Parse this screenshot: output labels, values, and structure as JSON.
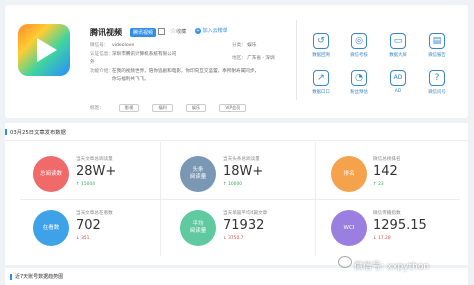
{
  "profile": {
    "name": "腾讯视频",
    "badge": "腾讯视频",
    "fav_label": "收藏",
    "cloud_add_label": "加入云榜单",
    "wechat_label": "微信号：",
    "wechat_value": "videolove",
    "auth_label": "认证信息：",
    "auth_value": "深圳市腾讯计算机系统有限公司",
    "auth_suffix": "外",
    "func_label": "功能介绍：",
    "func_value": "在我的视频世界，陪你追剧和电影，你印向互交蓝蕾，奉所耐寿属同步，",
    "func_value2": "你与福利共飞飞。",
    "category_label": "分类：",
    "category_value": "娱乐",
    "region_label": "地区：",
    "region_value": "广东省 · 深圳",
    "tags_label": "标签：",
    "tags": [
      "影视",
      "福利",
      "娱乐",
      "VIP会员"
    ]
  },
  "tools": [
    {
      "label": "数据回溯",
      "icon": "history-icon"
    },
    {
      "label": "微信考核",
      "icon": "wechat-icon"
    },
    {
      "label": "数据大屏",
      "icon": "screen-icon"
    },
    {
      "label": "微信报告",
      "icon": "report-icon"
    },
    {
      "label": "数据口口",
      "icon": "data-icon"
    },
    {
      "label": "粉丝预估",
      "icon": "fans-icon"
    },
    {
      "label": "AD",
      "icon": "ad-icon"
    },
    {
      "label": "微信问号",
      "icon": "question-icon"
    }
  ],
  "section_title": "03月25日文章发布数据",
  "metrics": [
    {
      "circle": "总阅读数",
      "color": "#f06a6a",
      "label": "当天文章总阅读量",
      "value": "28W+",
      "delta": "↑ 15004",
      "delta_color": "#3aa65a"
    },
    {
      "circle": "头条\n阅读量",
      "color": "#7a97b3",
      "label": "当天头条总阅读量",
      "value": "18W+",
      "delta": "↑ 10000",
      "delta_color": "#3aa65a"
    },
    {
      "circle": "排名",
      "color": "#f4a34c",
      "label": "微信总榜排名",
      "value": "142",
      "delta": "↑ 23",
      "delta_color": "#3aa65a"
    },
    {
      "circle": "在看数",
      "color": "#3ea2e8",
      "label": "当天文章总在看数",
      "value": "702",
      "delta": "↓ 351",
      "delta_color": "#e24a4a"
    },
    {
      "circle": "平均\n阅读量",
      "color": "#5fc9a0",
      "label": "当天单篇平均4篇文章",
      "value": "71932",
      "delta": "↓ 3750.7",
      "delta_color": "#e24a4a"
    },
    {
      "circle": "WCI",
      "color": "#9b7fe0",
      "label": "微信传播指数",
      "value": "1295.15",
      "delta": "↓ 17.28",
      "delta_color": "#e24a4a"
    }
  ],
  "bottom_title": "近7天账号数据趋势图",
  "watermark": "微信号: xxpython"
}
